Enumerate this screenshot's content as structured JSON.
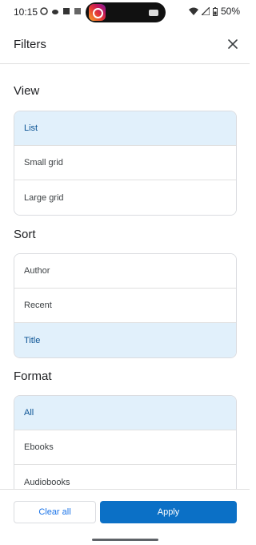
{
  "status_bar": {
    "time": "10:15",
    "battery": "50%"
  },
  "header": {
    "title": "Filters"
  },
  "sections": {
    "view": {
      "title": "View",
      "options": [
        "List",
        "Small grid",
        "Large grid"
      ],
      "selected": "List"
    },
    "sort": {
      "title": "Sort",
      "options": [
        "Author",
        "Recent",
        "Title"
      ],
      "selected": "Title"
    },
    "format": {
      "title": "Format",
      "options": [
        "All",
        "Ebooks",
        "Audiobooks"
      ],
      "selected": "All"
    }
  },
  "footer": {
    "clear_label": "Clear all",
    "apply_label": "Apply"
  },
  "colors": {
    "accent": "#0b70c6",
    "selected_bg": "#e1f0fb",
    "link": "#1a73e8"
  }
}
